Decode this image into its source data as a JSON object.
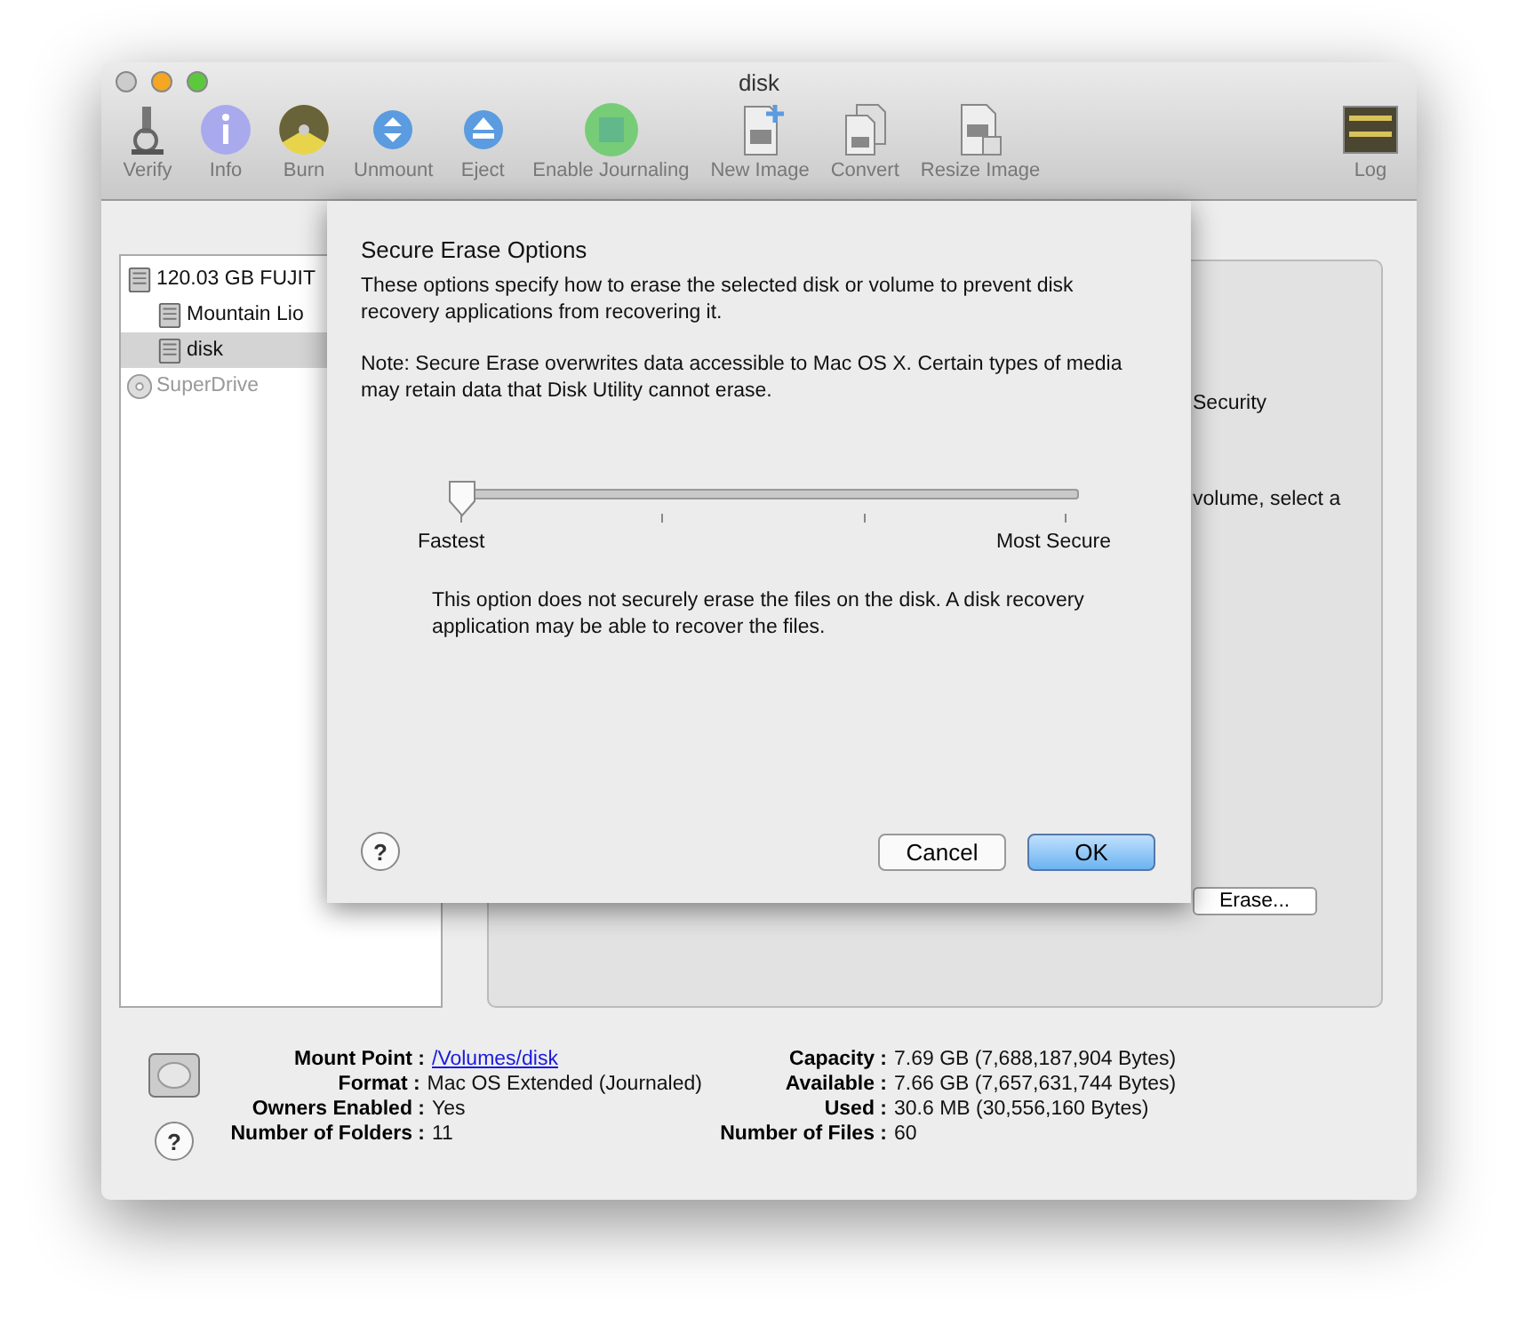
{
  "window": {
    "title": "disk"
  },
  "toolbar": [
    {
      "kind": "verify",
      "label": "Verify"
    },
    {
      "kind": "info",
      "label": "Info"
    },
    {
      "kind": "burn",
      "label": "Burn"
    },
    {
      "kind": "unmount",
      "label": "Unmount"
    },
    {
      "kind": "eject",
      "label": "Eject"
    },
    {
      "kind": "journal",
      "label": "Enable Journaling"
    },
    {
      "kind": "newimage",
      "label": "New Image"
    },
    {
      "kind": "convert",
      "label": "Convert"
    },
    {
      "kind": "resize",
      "label": "Resize Image"
    },
    {
      "kind": "log",
      "label": "Log"
    }
  ],
  "sidebar": {
    "items": [
      {
        "label": "120.03 GB FUJIT",
        "kind": "disk",
        "selected": false,
        "disabled": false,
        "children": [
          {
            "label": "Mountain Lio",
            "kind": "volume",
            "selected": false,
            "disabled": false
          },
          {
            "label": "disk",
            "kind": "volume",
            "selected": true,
            "disabled": false
          }
        ]
      },
      {
        "label": "SuperDrive",
        "kind": "optical",
        "selected": false,
        "disabled": true
      }
    ]
  },
  "panel": {
    "texts": [
      "Security",
      "volume, select a"
    ],
    "erase_button": "Erase..."
  },
  "sheet": {
    "title": "Secure Erase Options",
    "description": "These options specify how to erase the selected disk or volume to prevent disk recovery applications from recovering it.",
    "note": "Note: Secure Erase overwrites data accessible to Mac OS X.  Certain types of media may retain data that Disk Utility cannot erase.",
    "slider": {
      "level": 0,
      "min_label": "Fastest",
      "max_label": "Most Secure"
    },
    "option_text": "This option does not securely erase the files on the disk. A disk recovery application may be able to recover the files.",
    "help": "?",
    "buttons": [
      {
        "label": "Cancel",
        "kind": "cancel"
      },
      {
        "label": "OK",
        "kind": "default"
      }
    ]
  },
  "info": {
    "left": [
      {
        "label": "Mount Point :",
        "value": "/Volumes/disk",
        "kind": "link"
      },
      {
        "label": "Format :",
        "value": "Mac OS Extended (Journaled)",
        "kind": "text"
      },
      {
        "label": "Owners Enabled :",
        "value": "Yes",
        "kind": "text"
      },
      {
        "label": "Number of Folders :",
        "value": "11",
        "kind": "text"
      }
    ],
    "right": [
      {
        "label": "Capacity :",
        "value": "7.69 GB (7,688,187,904 Bytes)",
        "kind": "text"
      },
      {
        "label": "Available :",
        "value": "7.66 GB (7,657,631,744 Bytes)",
        "kind": "text"
      },
      {
        "label": "Used :",
        "value": "30.6 MB (30,556,160 Bytes)",
        "kind": "text"
      },
      {
        "label": "Number of Files :",
        "value": "60",
        "kind": "text"
      }
    ],
    "help": "?"
  }
}
